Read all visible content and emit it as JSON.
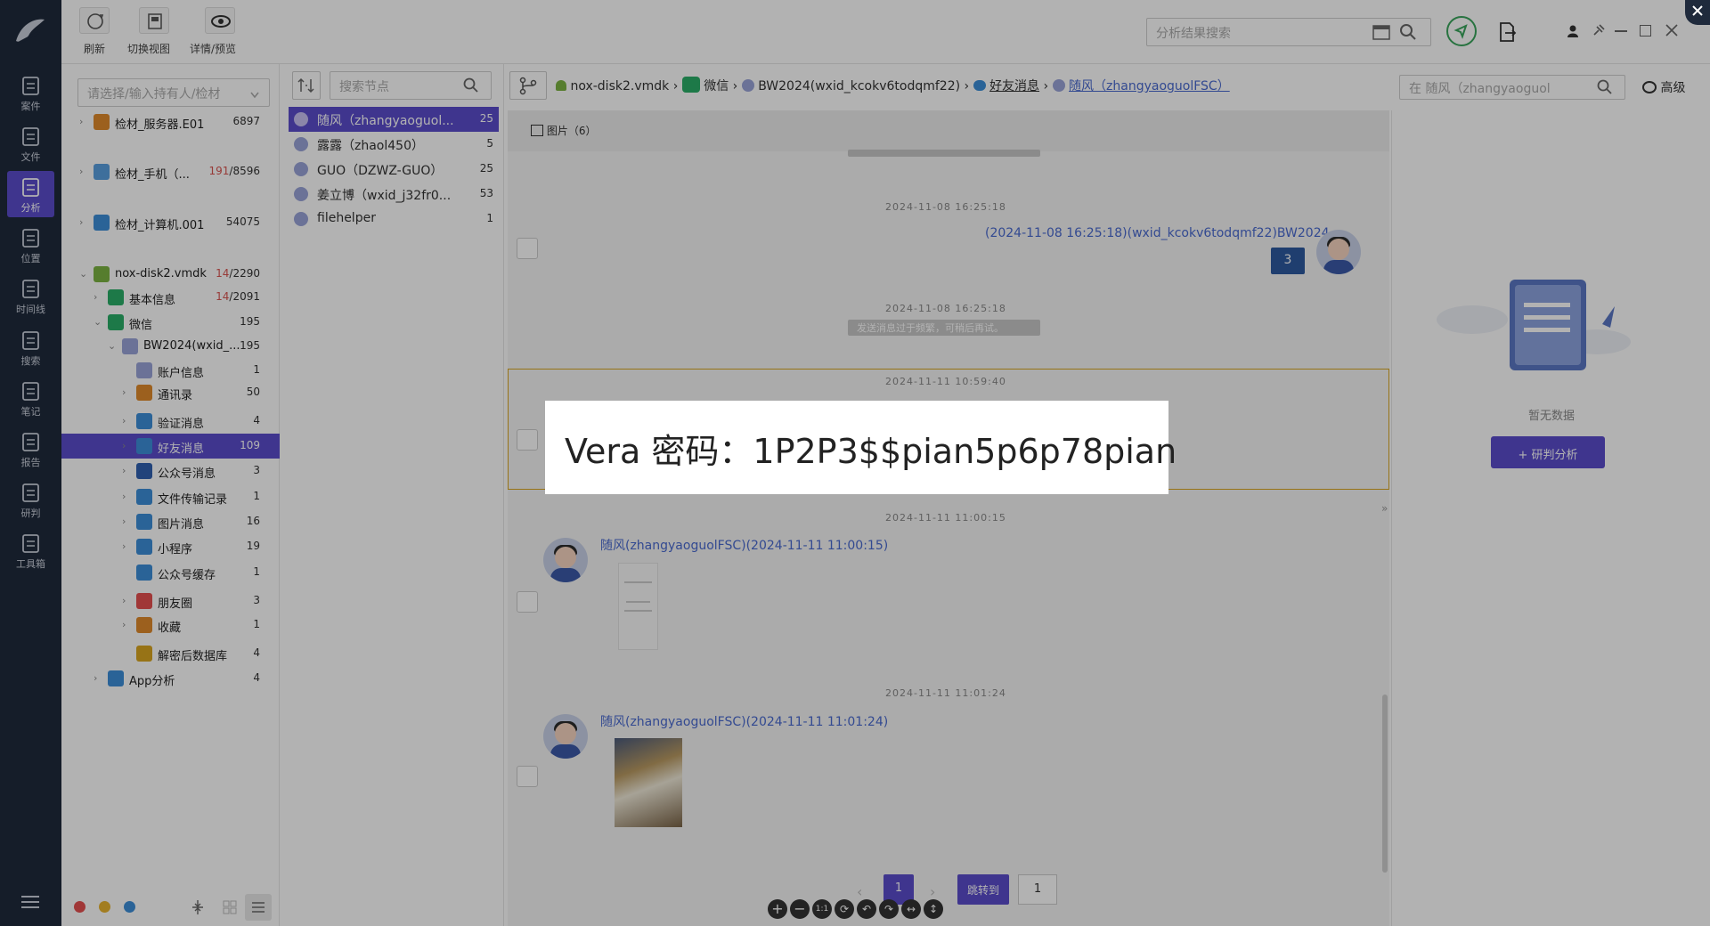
{
  "rail": {
    "items": [
      {
        "label": "案件",
        "icon": "case-icon"
      },
      {
        "label": "文件",
        "icon": "folder-icon"
      },
      {
        "label": "分析",
        "icon": "analysis-icon",
        "active": true
      },
      {
        "label": "位置",
        "icon": "location-pin-icon"
      },
      {
        "label": "时间线",
        "icon": "timeline-icon"
      },
      {
        "label": "搜索",
        "icon": "search-icon"
      },
      {
        "label": "笔记",
        "icon": "note-icon"
      },
      {
        "label": "报告",
        "icon": "report-icon"
      },
      {
        "label": "研判",
        "icon": "judge-icon"
      },
      {
        "label": "工具箱",
        "icon": "toolbox-icon"
      }
    ]
  },
  "toolbar": {
    "refresh": "刷新",
    "switch_view": "切换视图",
    "detail_preview": "详情/预览",
    "result_search_placeholder": "分析结果搜索"
  },
  "tree": {
    "holder_placeholder": "请选择/输入持有人/检材",
    "rows": [
      {
        "label": "检材_服务器.E01",
        "count": "6897",
        "chev": "›",
        "indent": 0
      },
      {
        "label": "检材_手机（...",
        "count": "/8596",
        "count_red": "191",
        "chev": "›",
        "indent": 0
      },
      {
        "label": "检材_计算机.001",
        "count": "54075",
        "chev": "›",
        "indent": 0
      },
      {
        "label": "nox-disk2.vmdk",
        "count": "/2290",
        "count_red": "14",
        "chev": "⌄",
        "indent": 0
      },
      {
        "label": "基本信息",
        "count": "/2091",
        "count_red": "14",
        "chev": "›",
        "indent": 1
      },
      {
        "label": "微信",
        "count": "195",
        "chev": "⌄",
        "indent": 1
      },
      {
        "label": "BW2024(wxid_...",
        "count": "195",
        "chev": "⌄",
        "indent": 2
      },
      {
        "label": "账户信息",
        "count": "1",
        "chev": "",
        "indent": 3
      },
      {
        "label": "通讯录",
        "count": "50",
        "chev": "›",
        "indent": 3
      },
      {
        "label": "验证消息",
        "count": "4",
        "chev": "›",
        "indent": 3
      },
      {
        "label": "好友消息",
        "count": "109",
        "chev": "›",
        "indent": 3,
        "selected": true
      },
      {
        "label": "公众号消息",
        "count": "3",
        "chev": "›",
        "indent": 3
      },
      {
        "label": "文件传输记录",
        "count": "1",
        "chev": "›",
        "indent": 3
      },
      {
        "label": "图片消息",
        "count": "16",
        "chev": "›",
        "indent": 3
      },
      {
        "label": "小程序",
        "count": "19",
        "chev": "›",
        "indent": 3
      },
      {
        "label": "公众号缓存",
        "count": "1",
        "chev": "",
        "indent": 3
      },
      {
        "label": "朋友圈",
        "count": "3",
        "chev": "›",
        "indent": 3
      },
      {
        "label": "收藏",
        "count": "1",
        "chev": "›",
        "indent": 3
      },
      {
        "label": "解密后数据库",
        "count": "4",
        "chev": "",
        "indent": 3
      },
      {
        "label": "App分析",
        "count": "4",
        "chev": "›",
        "indent": 1
      }
    ]
  },
  "nodes": {
    "search_placeholder": "搜索节点",
    "items": [
      {
        "name": "随风（zhangyaoguol...",
        "count": "25",
        "selected": true
      },
      {
        "name": "露露（zhaol450）",
        "count": "5"
      },
      {
        "name": "GUO（DZWZ-GUO）",
        "count": "25"
      },
      {
        "name": "姜立博（wxid_j32fr0...",
        "count": "53"
      },
      {
        "name": "filehelper",
        "count": "1"
      }
    ]
  },
  "breadcrumb": {
    "items": [
      "nox-disk2.vmdk",
      "微信",
      "BW2024(wxid_kcokv6todqmf22)",
      "好友消息",
      "随风（zhangyaoguolFSC）"
    ],
    "search_placeholder": "在 随风（zhangyaoguol",
    "advanced": "高级"
  },
  "tab": {
    "label": "图片",
    "count": "（6）"
  },
  "chat": {
    "ts1": "2024-11-08 16:25:18",
    "out_sender": "(2024-11-08 16:25:18)(wxid_kcokv6todqmf22)BW2024",
    "out_bubble": "3",
    "ts2": "2024-11-08 16:25:18",
    "sys2": "发送消息过于频繁，可稍后再试。",
    "ts3": "2024-11-11 10:59:40",
    "ts4": "2024-11-11 11:00:15",
    "in1_sender": "随风(zhangyaoguolFSC)(2024-11-11 11:00:15)",
    "ts5": "2024-11-11 11:01:24",
    "in2_sender": "随风(zhangyaoguolFSC)(2024-11-11 11:01:24)"
  },
  "pager": {
    "current": "1",
    "jump": "跳转到",
    "jump_value": "1"
  },
  "right": {
    "empty": "暂无数据",
    "analyze": "+ 研判分析"
  },
  "popup": {
    "text": "Vera 密码：1P2P3$$pian5p6p78pian"
  },
  "colors": {
    "accent": "#5b4ccc",
    "rail": "#1f2a3c",
    "link": "#4a6ad0"
  }
}
